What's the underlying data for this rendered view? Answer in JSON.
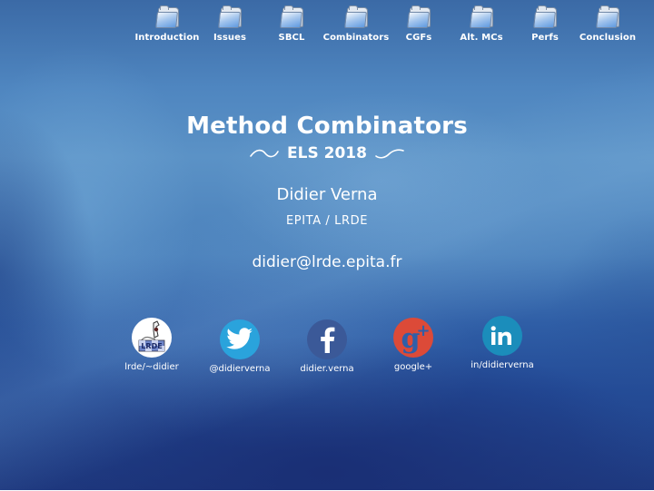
{
  "navigation": {
    "items": [
      {
        "label": "Introduction",
        "icon": "folder-icon"
      },
      {
        "label": "Issues",
        "icon": "folder-icon"
      },
      {
        "label": "SBCL",
        "icon": "folder-icon"
      },
      {
        "label": "Combinators",
        "icon": "folder-icon"
      },
      {
        "label": "CGFs",
        "icon": "folder-icon"
      },
      {
        "label": "Alt. MCs",
        "icon": "folder-icon"
      },
      {
        "label": "Perfs",
        "icon": "folder-icon"
      },
      {
        "label": "Conclusion",
        "icon": "folder-icon"
      }
    ]
  },
  "title": {
    "main": "Method Combinators",
    "subtitle": "ELS 2018",
    "subtitle_ornament": "swash"
  },
  "author": {
    "name": "Didier Verna",
    "affiliation": "EPITA / LRDE",
    "email": "didier@lrde.epita.fr"
  },
  "social": {
    "items": [
      {
        "label": "lrde/~didier",
        "icon": "lrde-icon",
        "color": "#ffffff"
      },
      {
        "label": "@didierverna",
        "icon": "twitter-icon",
        "color": "#2aa3dc"
      },
      {
        "label": "didier.verna",
        "icon": "facebook-icon",
        "color": "#3b5998"
      },
      {
        "label": "google+",
        "icon": "google-plus-icon",
        "color": "#dc4a38"
      },
      {
        "label": "in/didierverna",
        "icon": "linkedin-icon",
        "color": "#1b8dbb"
      }
    ]
  },
  "colors": {
    "background_top": "#3b6aa6",
    "background_bottom": "#1f3a80",
    "text": "#ffffff"
  }
}
